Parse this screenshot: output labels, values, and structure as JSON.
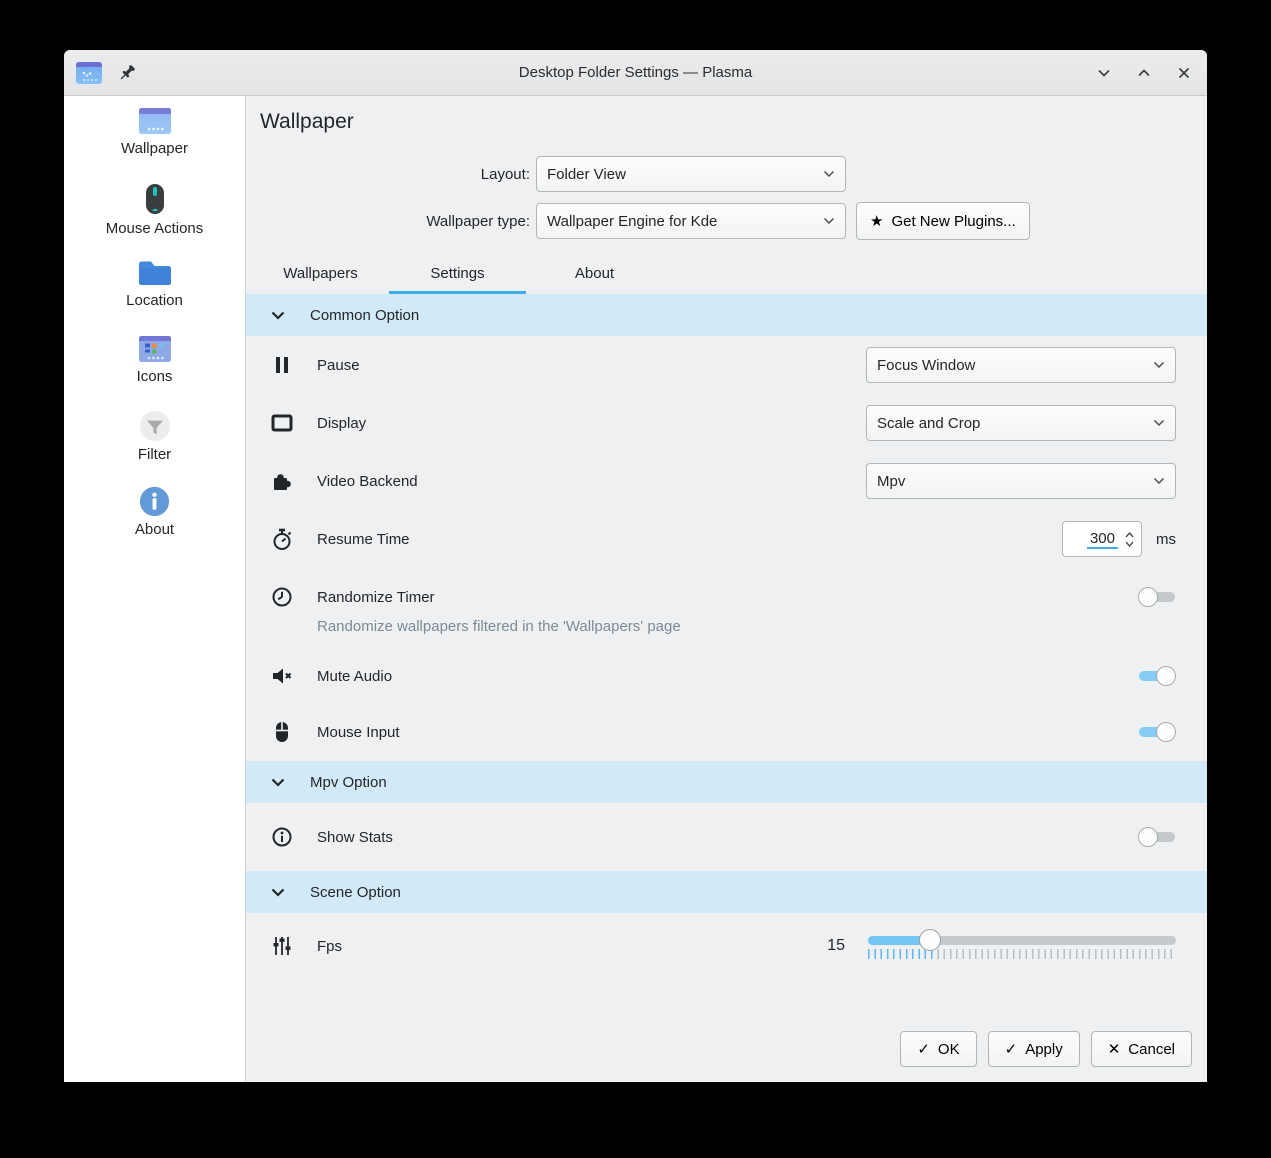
{
  "window": {
    "title": "Desktop Folder Settings — Plasma"
  },
  "icons": {
    "star": "★",
    "check": "✓",
    "close": "✕"
  },
  "sidebar": {
    "items": [
      {
        "label": "Wallpaper"
      },
      {
        "label": "Mouse Actions"
      },
      {
        "label": "Location"
      },
      {
        "label": "Icons"
      },
      {
        "label": "Filter"
      },
      {
        "label": "About"
      }
    ]
  },
  "header": {
    "page_title": "Wallpaper",
    "layout": {
      "label": "Layout:",
      "value": "Folder View"
    },
    "wallpaper_type": {
      "label": "Wallpaper type:",
      "value": "Wallpaper Engine for Kde"
    },
    "get_new_plugins_label": "Get New Plugins..."
  },
  "tab_bar": {
    "active": "Settings",
    "items": [
      {
        "label": "Wallpapers"
      },
      {
        "label": "Settings"
      },
      {
        "label": "About"
      }
    ]
  },
  "settings": {
    "common": {
      "header": "Common Option",
      "pause": {
        "label": "Pause",
        "value": "Focus Window"
      },
      "display": {
        "label": "Display",
        "value": "Scale and Crop"
      },
      "video_backend": {
        "label": "Video Backend",
        "value": "Mpv"
      },
      "resume_time": {
        "label": "Resume Time",
        "value": "300",
        "unit": "ms"
      },
      "randomize_timer": {
        "label": "Randomize Timer",
        "state": "off",
        "hint": "Randomize wallpapers filtered in the 'Wallpapers' page"
      },
      "mute_audio": {
        "label": "Mute Audio",
        "state": "on"
      },
      "mouse_input": {
        "label": "Mouse Input",
        "state": "on"
      }
    },
    "mpv": {
      "header": "Mpv Option",
      "show_stats": {
        "label": "Show Stats",
        "state": "off"
      }
    },
    "scene": {
      "header": "Scene Option",
      "fps": {
        "label": "Fps",
        "value": "15",
        "slider_percent": 20,
        "slider_min_hint": "",
        "slider_max_hint": ""
      }
    }
  },
  "footer": {
    "ok": "OK",
    "apply": "Apply",
    "cancel": "Cancel"
  },
  "colors": {
    "accent": "#3daee9",
    "section_header_bg": "#d2e9f7",
    "toggle_on": "#85ccf3"
  }
}
